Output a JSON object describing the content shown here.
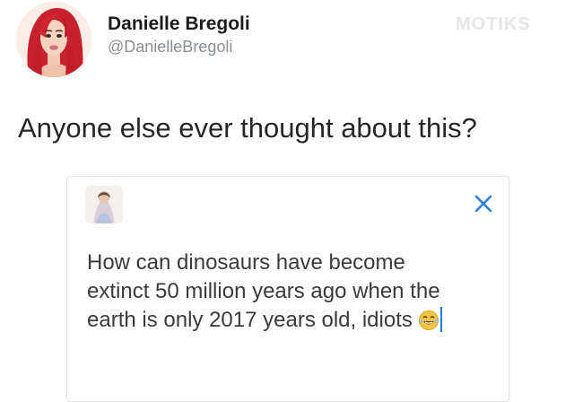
{
  "tweet": {
    "author": {
      "display_name": "Danielle Bregoli",
      "handle": "@DanielleBregoli",
      "avatar_icon": "cartoon-avatar-icon"
    },
    "text": "Anyone else ever thought about this?",
    "watermark": "MOTIKS"
  },
  "compose": {
    "avatar_icon": "user-photo-icon",
    "close_icon": "close-x-icon",
    "text_before_emoji": "How can dinosaurs have become extinct 50 million years ago when the earth is only 2017 years old, idiots",
    "emoji_icon": "laughing-tears-emoji-icon",
    "accent_color": "#2b7de0"
  }
}
